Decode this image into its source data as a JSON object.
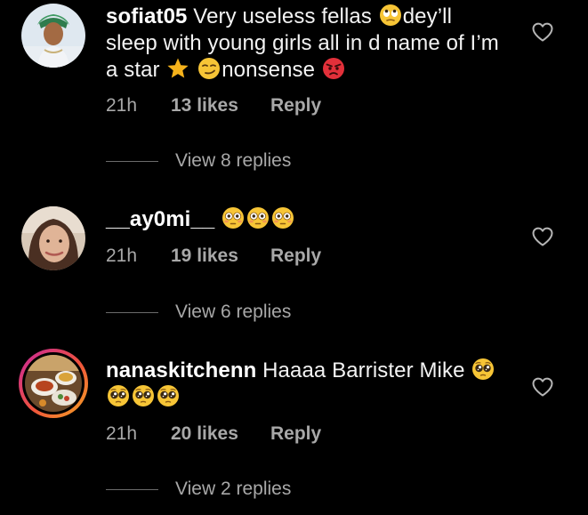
{
  "comments": [
    {
      "username": "sofiat05",
      "text_a": " Very useless fellas ",
      "text_b": "dey’ll sleep with young girls all in d name of I’m a star ",
      "text_c": "nonsense ",
      "emojis": [
        "face-with-rolling-eyes-emoji",
        "star-emoji",
        "smirking-face-emoji",
        "angry-face-emoji"
      ],
      "time": "21h",
      "likes": "13 likes",
      "reply": "Reply",
      "view_replies": "View 8 replies"
    },
    {
      "username": "__ay0mi__",
      "text_a": " ",
      "emojis": [
        "flushed-face-emoji",
        "flushed-face-emoji",
        "flushed-face-emoji"
      ],
      "time": "21h",
      "likes": "19 likes",
      "reply": "Reply",
      "view_replies": "View 6 replies"
    },
    {
      "username": "nanaskitchenn",
      "text_a": " Haaaa Barrister Mike ",
      "emojis": [
        "pleading-face-emoji",
        "pleading-face-emoji",
        "pleading-face-emoji",
        "pleading-face-emoji"
      ],
      "time": "21h",
      "likes": "20 likes",
      "reply": "Reply",
      "view_replies": "View 2 replies"
    }
  ],
  "icons": {
    "like": "heart-outline-icon"
  },
  "colors": {
    "background": "#000000",
    "primary_text": "#f3f3f3",
    "secondary_text": "#a8a8a8",
    "story_ring_start": "#c8269d",
    "story_ring_end": "#f5a623"
  }
}
